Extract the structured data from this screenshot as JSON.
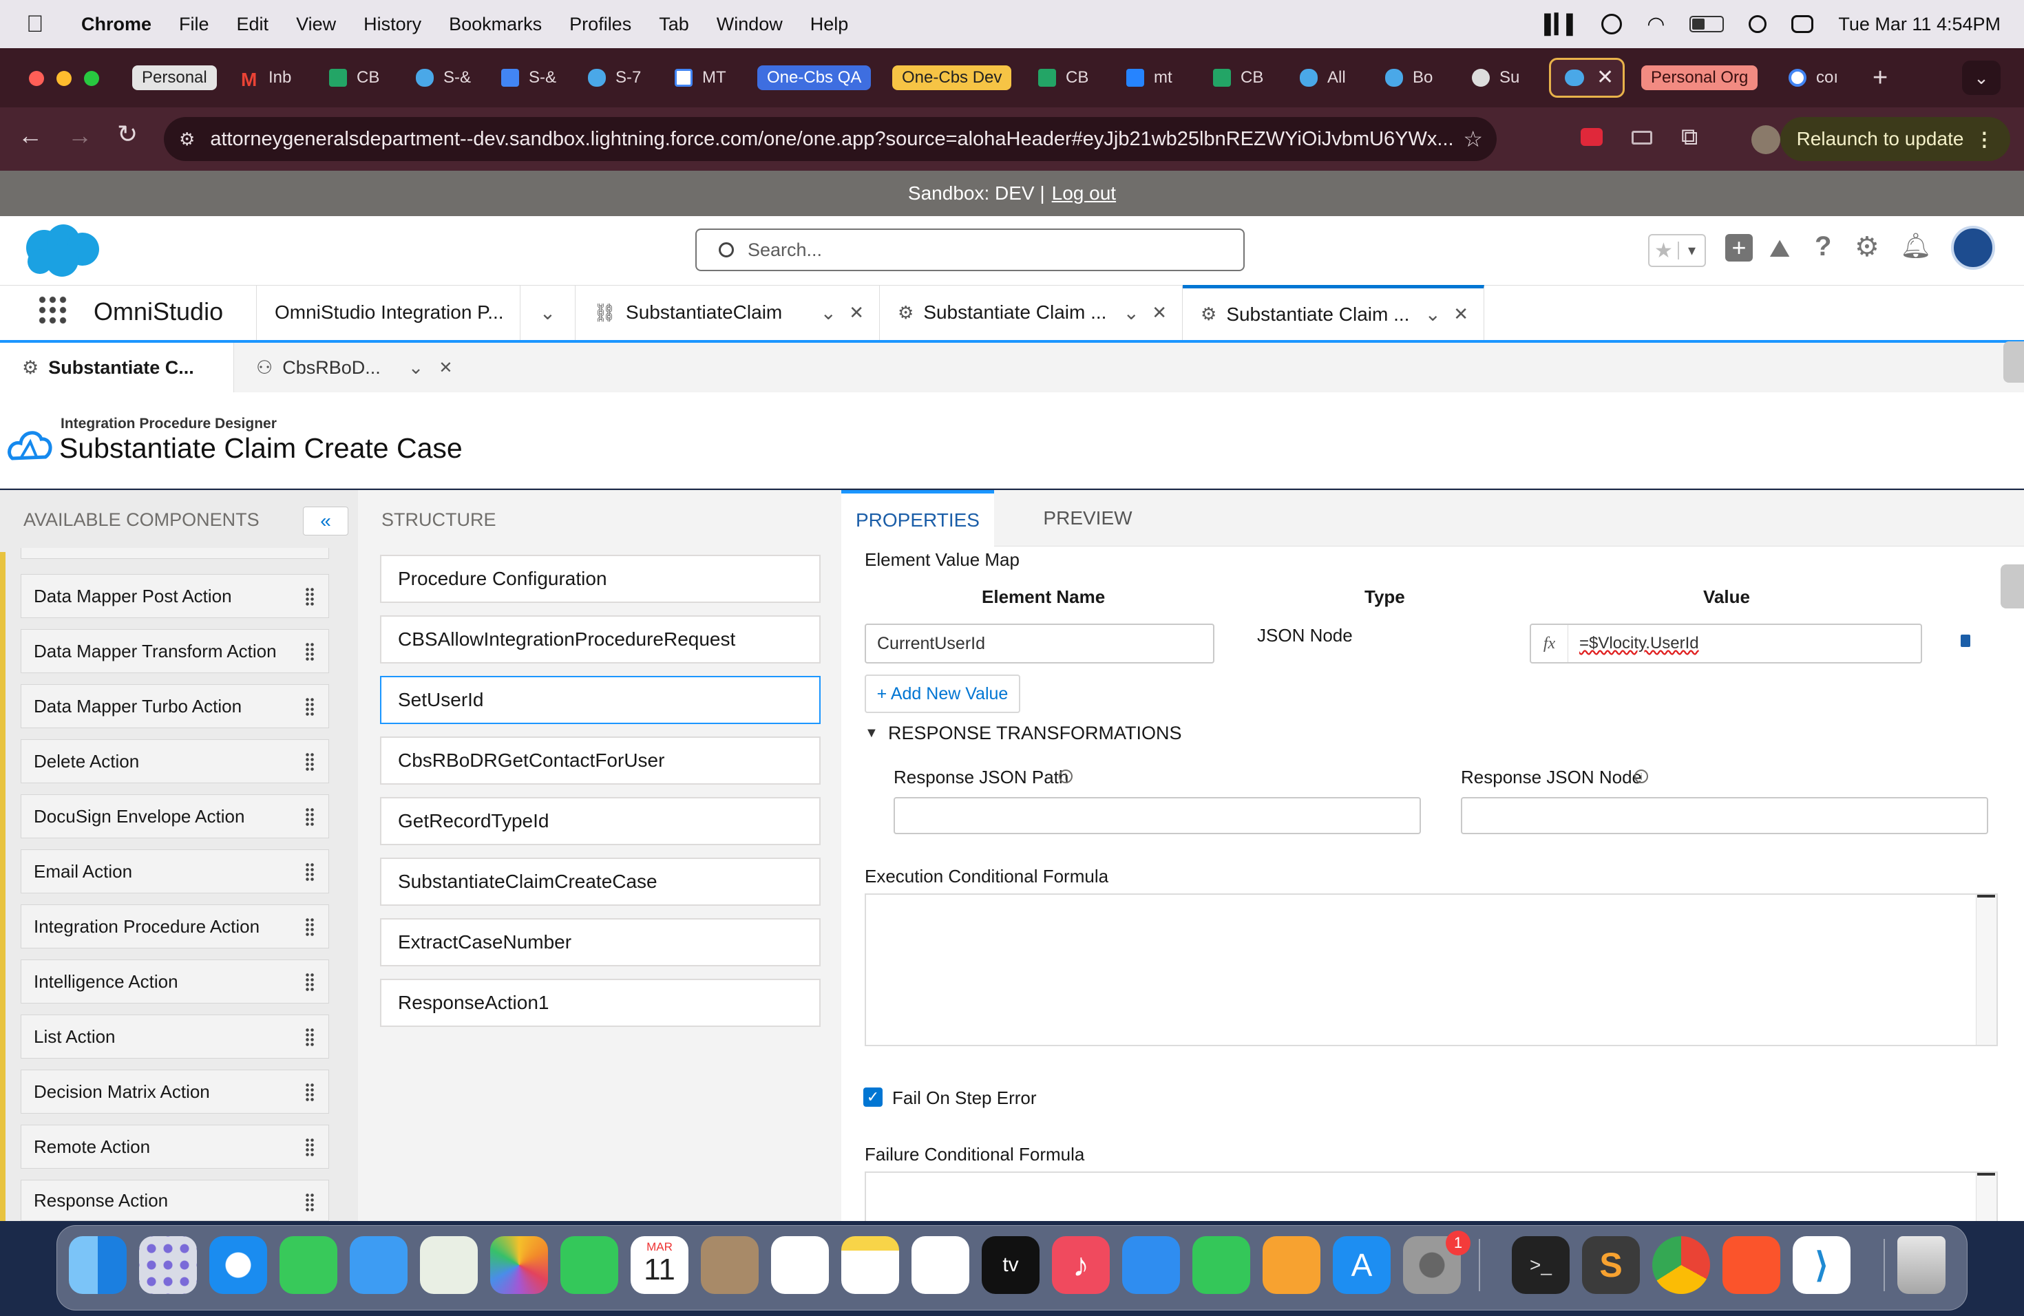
{
  "menubar": {
    "app": "Chrome",
    "items": [
      "File",
      "Edit",
      "View",
      "History",
      "Bookmarks",
      "Profiles",
      "Tab",
      "Window",
      "Help"
    ],
    "clock": "Tue Mar 11  4:54PM"
  },
  "browser_tabs": [
    {
      "label": "Personal",
      "type": "group"
    },
    {
      "label": "Inb",
      "icon": "gmail-icon"
    },
    {
      "label": "CB",
      "icon": "sheets-icon"
    },
    {
      "label": "S-&",
      "icon": "salesforce-icon"
    },
    {
      "label": "S-&",
      "icon": "docs-icon"
    },
    {
      "label": "S-7",
      "icon": "salesforce-icon"
    },
    {
      "label": "MT",
      "icon": "calendar-icon"
    },
    {
      "label": "One-Cbs QA",
      "type": "group"
    },
    {
      "label": "One-Cbs Dev",
      "type": "group"
    },
    {
      "label": "CB",
      "icon": "sheets-icon"
    },
    {
      "label": "mt",
      "icon": "bitbucket-icon"
    },
    {
      "label": "CB",
      "icon": "sheets-icon"
    },
    {
      "label": "All",
      "icon": "salesforce-icon"
    },
    {
      "label": "Bo",
      "icon": "salesforce-icon"
    },
    {
      "label": "Su",
      "icon": "github-icon"
    },
    {
      "label": "",
      "icon": "salesforce-icon",
      "active": true
    },
    {
      "label": "Personal Org",
      "type": "group"
    },
    {
      "label": "coı",
      "icon": "google-icon"
    }
  ],
  "address": {
    "url": "attorneygeneralsdepartment--dev.sandbox.lightning.force.com/one/one.app?source=alohaHeader#eyJjb21wb25lbnREZWYiOiJvbmU6YWx...",
    "relaunch": "Relaunch to update"
  },
  "sandbox": {
    "text": "Sandbox: DEV |",
    "logout": "Log out"
  },
  "sf": {
    "search_placeholder": "Search...",
    "app_name": "OmniStudio"
  },
  "nav_tabs": [
    {
      "label": "OmniStudio Integration P..."
    },
    {
      "label": "SubstantiateClaim"
    },
    {
      "label": "Substantiate Claim ..."
    },
    {
      "label": "Substantiate Claim ..."
    }
  ],
  "sub_tabs": [
    {
      "label": "Substantiate C..."
    },
    {
      "label": "CbsRBoD..."
    }
  ],
  "designer": {
    "kicker": "Integration Procedure Designer",
    "title": "Substantiate Claim Create Case"
  },
  "left_panel": {
    "title": "AVAILABLE COMPONENTS",
    "collapse": "«",
    "components": [
      "Data Mapper Post Action",
      "Data Mapper Transform Action",
      "Data Mapper Turbo Action",
      "Delete Action",
      "DocuSign Envelope Action",
      "Email Action",
      "Integration Procedure Action",
      "Intelligence Action",
      "List Action",
      "Decision Matrix Action",
      "Remote Action",
      "Response Action"
    ]
  },
  "structure": {
    "title": "STRUCTURE",
    "steps": [
      "Procedure Configuration",
      "CBSAllowIntegrationProcedureRequest",
      "SetUserId",
      "CbsRBoDRGetContactForUser",
      "GetRecordTypeId",
      "SubstantiateClaimCreateCase",
      "ExtractCaseNumber",
      "ResponseAction1"
    ],
    "selected_index": 2
  },
  "properties": {
    "tabs": [
      "PROPERTIES",
      "PREVIEW"
    ],
    "section": "Element Value Map",
    "cols": {
      "name": "Element Name",
      "type": "Type",
      "value": "Value"
    },
    "row": {
      "name": "CurrentUserId",
      "type": "JSON Node",
      "fx": "fx",
      "value": "=$Vlocity.UserId"
    },
    "add_value": "+ Add New Value",
    "response_heading": "RESPONSE TRANSFORMATIONS",
    "response_path_label": "Response JSON Path",
    "response_node_label": "Response JSON Node",
    "exec_formula": "Execution Conditional Formula",
    "fail_on_error": "Fail On Step Error",
    "fail_on_error_checked": true,
    "failure_formula": "Failure Conditional Formula"
  },
  "dock": {
    "calendar_month": "MAR",
    "calendar_day": "11",
    "settings_badge": "1"
  }
}
